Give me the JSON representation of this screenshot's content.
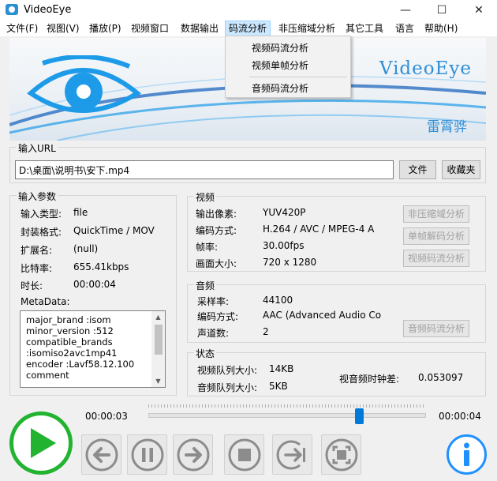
{
  "window": {
    "title": "VideoEye",
    "minimize": "—",
    "maximize": "☐",
    "close": "✕"
  },
  "menu": {
    "items": [
      "文件(F)",
      "视图(V)",
      "播放(P)",
      "视频窗口",
      "数据输出",
      "码流分析",
      "非压缩域分析",
      "其它工具",
      "语言",
      "帮助(H)"
    ],
    "open_index": 5,
    "dropdown": [
      "视频码流分析",
      "视频单帧分析",
      "音频码流分析"
    ]
  },
  "banner": {
    "title": "VideoEye",
    "author": "雷霄骅",
    "eye_color": "#1e9be8"
  },
  "input_url": {
    "group_title": "输入URL",
    "value": "D:\\桌面\\说明书\\安下.mp4",
    "file_button": "文件",
    "favorites_button": "收藏夹"
  },
  "input_params": {
    "group_title": "输入参数",
    "rows": [
      {
        "label": "输入类型:",
        "value": "file"
      },
      {
        "label": "封装格式:",
        "value": "QuickTime / MOV"
      },
      {
        "label": "扩展名:",
        "value": "(null)"
      },
      {
        "label": "比特率:",
        "value": "655.41kbps"
      },
      {
        "label": "时长:",
        "value": "00:00:04"
      }
    ],
    "metadata_label": "MetaData:",
    "metadata_lines": [
      "major_brand        :isom",
      "minor_version      :512",
      "compatible_brands",
      ":isomiso2avc1mp41",
      "encoder   :Lavf58.12.100",
      "comment"
    ]
  },
  "video": {
    "group_title": "视频",
    "rows": [
      {
        "label": "输出像素:",
        "value": "YUV420P"
      },
      {
        "label": "编码方式:",
        "value": "H.264 / AVC / MPEG-4 A"
      },
      {
        "label": "帧率:",
        "value": "30.00fps"
      },
      {
        "label": "画面大小:",
        "value": "720 x 1280"
      }
    ],
    "buttons": [
      "非压缩域分析",
      "单帧解码分析",
      "视频码流分析"
    ]
  },
  "audio": {
    "group_title": "音频",
    "rows": [
      {
        "label": "采样率:",
        "value": "44100"
      },
      {
        "label": "编码方式:",
        "value": "AAC (Advanced Audio Co"
      },
      {
        "label": "声道数:",
        "value": "2"
      }
    ],
    "button": "音频码流分析"
  },
  "status": {
    "group_title": "状态",
    "video_queue_label": "视频队列大小:",
    "video_queue_value": "14KB",
    "audio_queue_label": "音频队列大小:",
    "audio_queue_value": "5KB",
    "av_diff_label": "视音频时钟差:",
    "av_diff_value": "0.053097"
  },
  "playback": {
    "current_time": "00:00:03",
    "total_time": "00:00:04",
    "progress": 0.75,
    "accent": "#22b330",
    "info_color": "#1e90ff"
  }
}
